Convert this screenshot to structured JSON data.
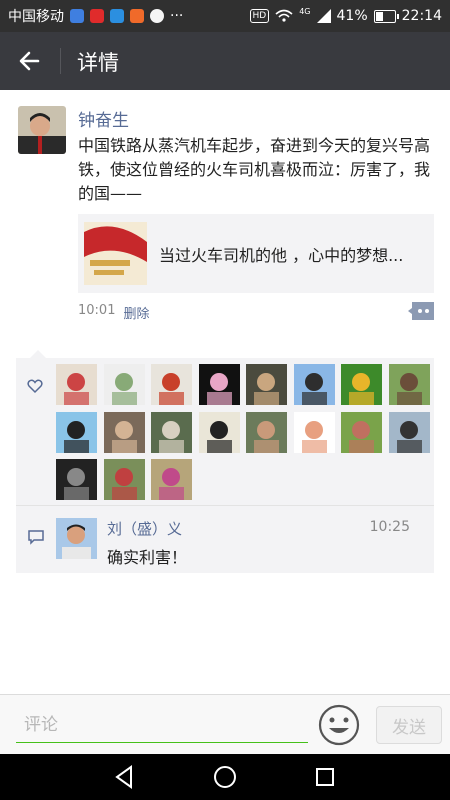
{
  "status_bar": {
    "carrier": "中国移动",
    "app_icons": [
      "pen-app-icon",
      "video-app-icon",
      "browser-app-icon",
      "media-app-icon",
      "weather-app-icon"
    ],
    "more": "···",
    "hd": "HD",
    "network": "4G",
    "battery": "41%",
    "battery_level": 0.41,
    "time": "22:14"
  },
  "title_bar": {
    "title": "详情"
  },
  "post": {
    "author": "钟奋生",
    "text": "中国铁路从蒸汽机车起步，奋进到今天的复兴号高铁，使这位曾经的火车司机喜极而泣：厉害了，我的国——",
    "link_title": "当过火车司机的他 ，心中的梦想...",
    "time": "10:01",
    "delete_label": "删除"
  },
  "likes": {
    "count": 19
  },
  "comments": [
    {
      "name": "刘（盛）义",
      "time": "10:25",
      "text": "确实利害！"
    }
  ],
  "input": {
    "placeholder": "评论",
    "send_label": "发送"
  },
  "colors": {
    "link_blue": "#576b95",
    "title_bar": "#393a3f",
    "accent_green": "#45c01a"
  }
}
